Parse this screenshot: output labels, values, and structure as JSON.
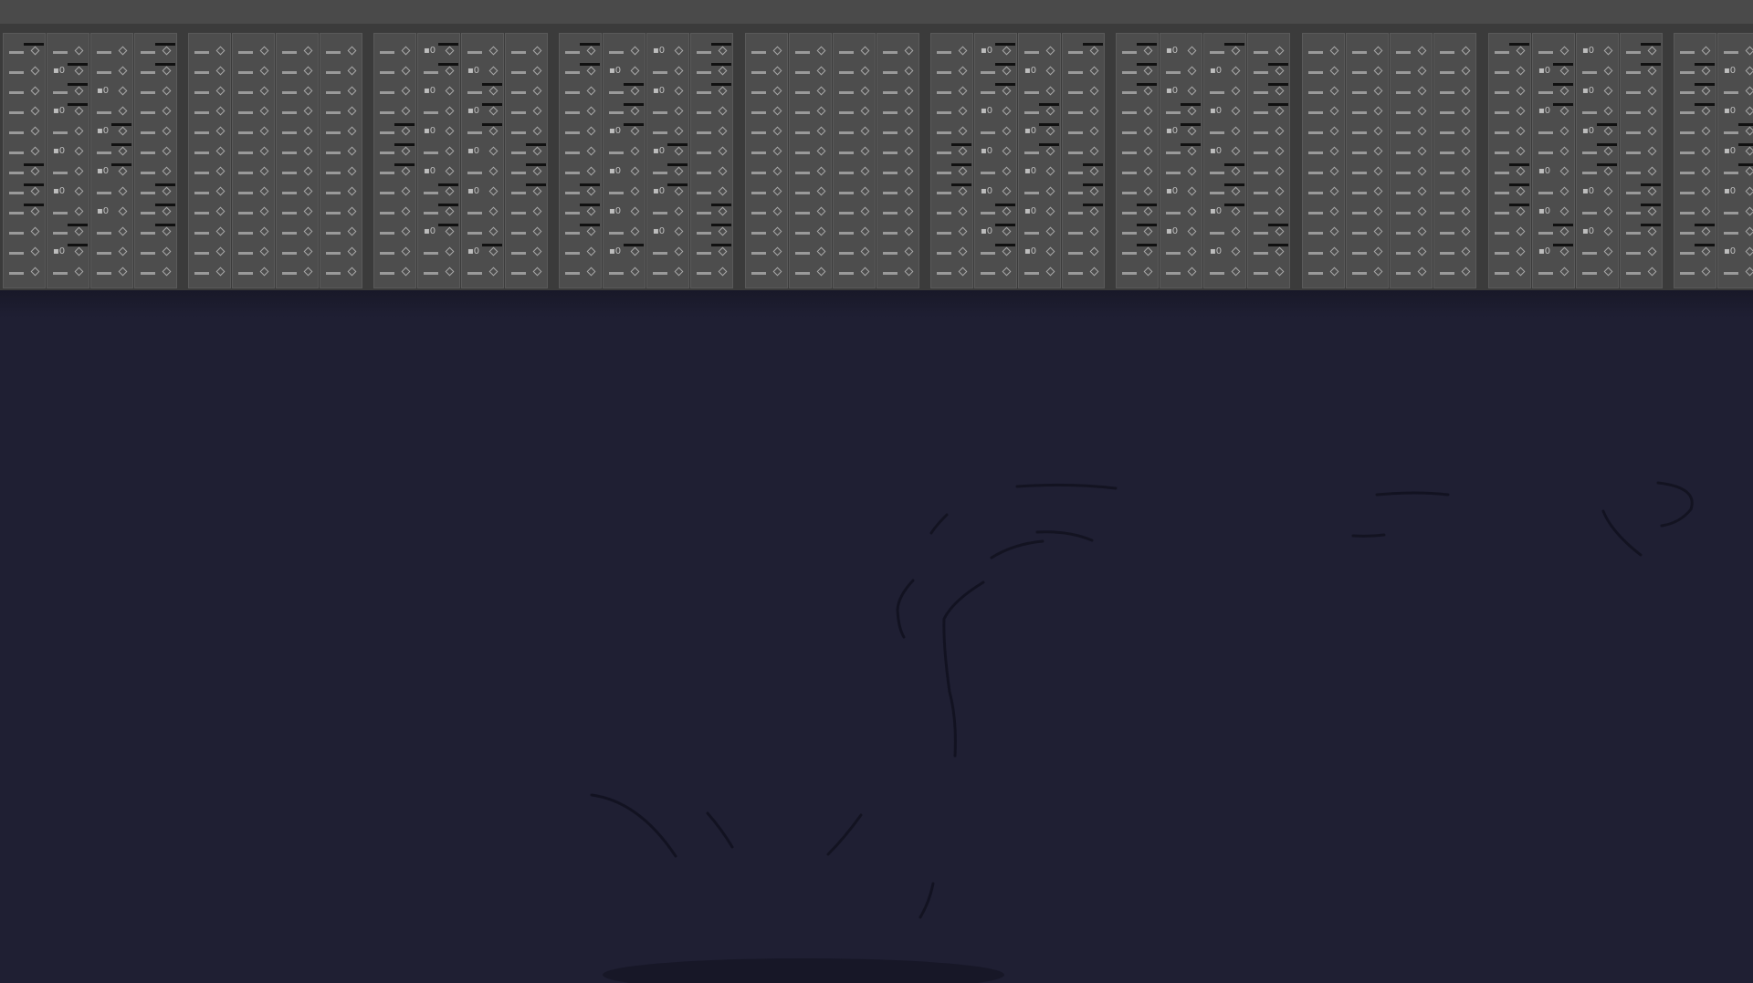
{
  "app": {
    "mixer": {
      "groups": 10,
      "channels_per_group": 4,
      "rows_per_channel": 12,
      "zero_label": "0"
    },
    "colors": {
      "background": "#1f1f33",
      "rack": "#3b3b3b",
      "channel": "#4d4d4d",
      "toolbar": "#4a4a4a"
    },
    "icons": {
      "fader": "fader-icon",
      "knob": "knob-icon"
    }
  }
}
